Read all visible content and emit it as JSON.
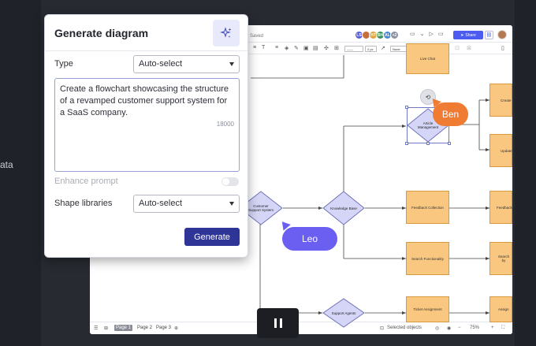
{
  "side_text": "ata",
  "topbar": {
    "saved": "Saved",
    "avatars": [
      {
        "initials": "LS",
        "color": "#5b5fd6"
      },
      {
        "initials": "",
        "color": "#c96f3a"
      },
      {
        "initials": "HT",
        "color": "#e2a33b"
      },
      {
        "initials": "BH",
        "color": "#3e8f5e"
      },
      {
        "initials": "AL",
        "color": "#4b86d1"
      },
      {
        "initials": "+2",
        "color": "#8d92a3"
      }
    ],
    "share_label": "Share"
  },
  "toolbar": {
    "line_style": "——",
    "line_width": "2 px",
    "arrow_start": "None",
    "arrow_end": "—▸"
  },
  "nodes": {
    "live_chat": "Live Chat",
    "create": "Create",
    "article_management": "Article Management",
    "update": "Update",
    "customer_support_system": "Customer Support System",
    "knowledge_base": "Knowledge Base",
    "feedback_collection": "Feedback Collection",
    "feedback_right": "Feedback",
    "search_functionality": "Search Functionality",
    "search_right": "Search by",
    "support_agents": "Support Agents",
    "ticket_assignment": "Ticket Assignment",
    "assign": "Assign"
  },
  "cursors": {
    "ben": "Ben",
    "leo": "Leo"
  },
  "bottombar": {
    "pages": [
      "Page 1",
      "Page 2",
      "Page 3"
    ],
    "selected_objects": "Selected objects",
    "zoom": "75%"
  },
  "dialog": {
    "title": "Generate diagram",
    "type_label": "Type",
    "type_value": "Auto-select",
    "prompt_text": "Create a flowchart showcasing the structure of a revamped customer support system for a SaaS company.",
    "char_count": "18000",
    "enhance_label": "Enhance prompt",
    "shape_libraries_label": "Shape libraries",
    "shape_libraries_value": "Auto-select",
    "generate_label": "Generate"
  },
  "colors": {
    "accent": "#2e3596",
    "node_fill": "#f9c77f",
    "diamond_fill": "#d5d6f7",
    "ben": "#f07b33",
    "leo": "#6a5ff0"
  }
}
